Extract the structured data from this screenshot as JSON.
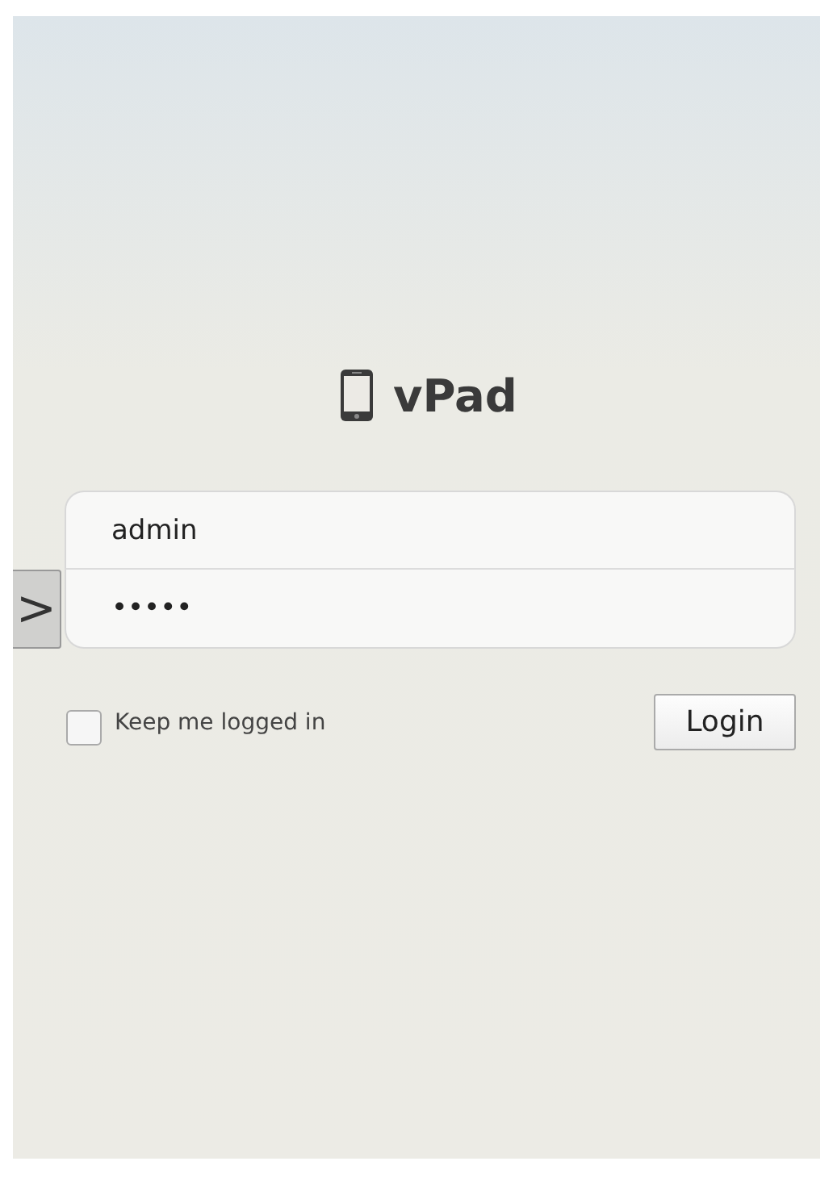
{
  "app": {
    "title": "vPad"
  },
  "login_form": {
    "username": "admin",
    "password": "•••••"
  },
  "keep_logged_in": {
    "label": "Keep me logged in",
    "checked": false
  },
  "login_button": {
    "label": "Login"
  },
  "side_tab": {
    "icon": ">"
  }
}
